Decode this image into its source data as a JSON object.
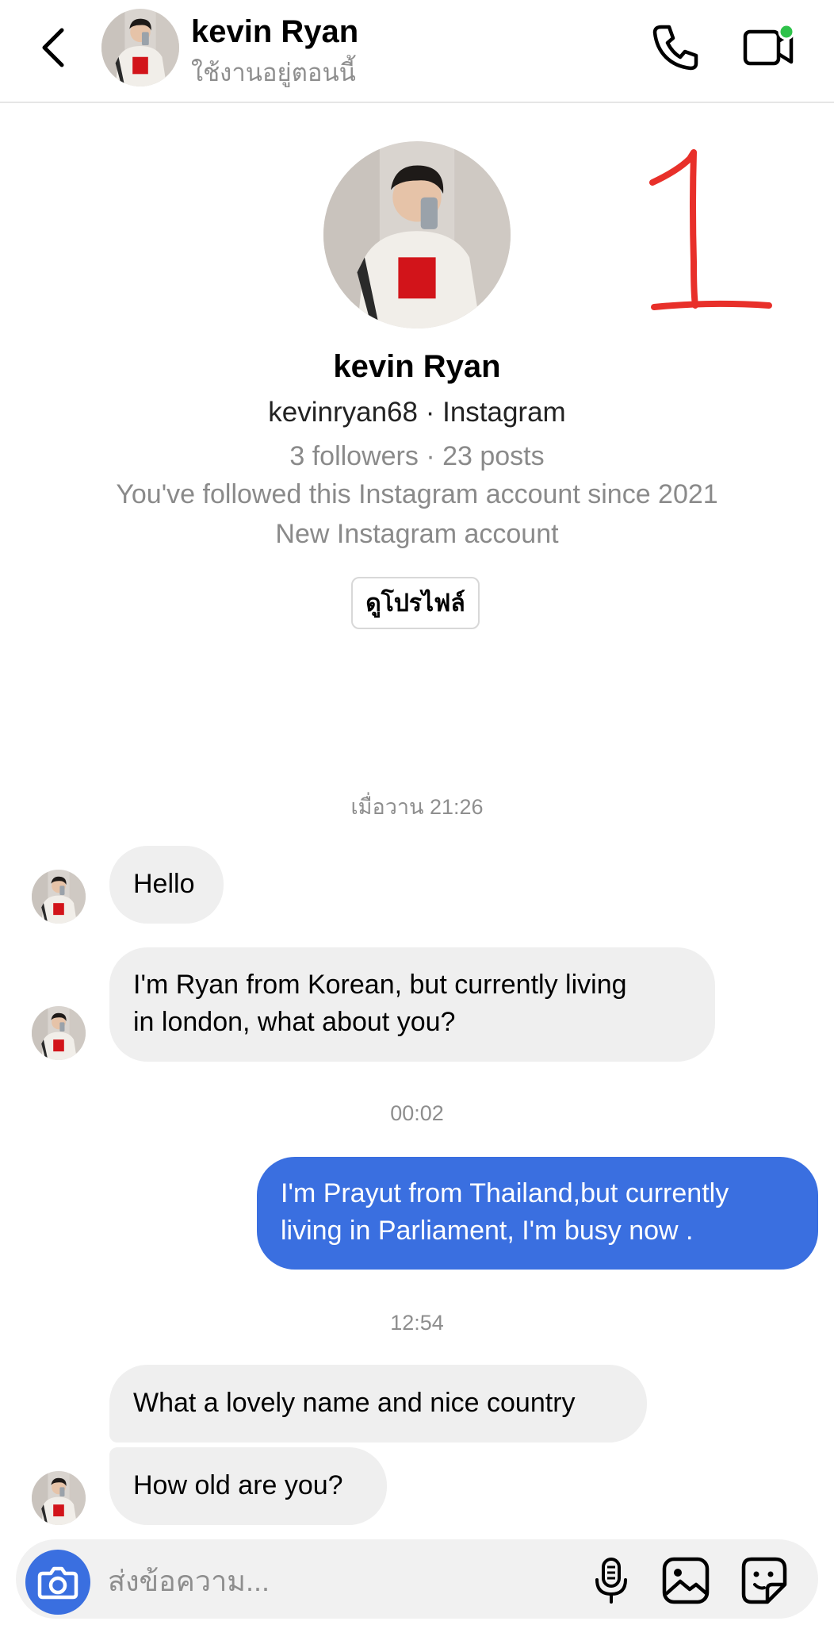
{
  "header": {
    "name": "kevin Ryan",
    "status": "ใช้งานอยู่ตอนนี้"
  },
  "profile": {
    "name": "kevin Ryan",
    "handle_line": "kevinryan68 · Instagram",
    "stats": "3 followers · 23 posts",
    "followed_since": "You've followed this Instagram account since 2021",
    "note": "New Instagram account",
    "view_profile_label": "ดูโปรไฟล์"
  },
  "timestamps": {
    "t1": "เมื่อวาน 21:26",
    "t2": "00:02",
    "t3": "12:54"
  },
  "messages": {
    "m1": "Hello",
    "m2_line1": "I'm Ryan from Korean, but currently living",
    "m2_line2": "in london, what about you?",
    "m3_line1": "I'm Prayut from Thailand,but currently",
    "m3_line2": "living in Parliament, I'm busy now .",
    "m4": "What a lovely name and nice country",
    "m5": "How old are you?"
  },
  "composer": {
    "placeholder": "ส่งข้อความ..."
  },
  "colors": {
    "accent": "#3a6fe0",
    "incoming_bubble": "#efefef",
    "online_dot": "#2ec24a",
    "annotation": "#e8302a"
  },
  "icons": [
    "back-icon",
    "phone-icon",
    "video-icon",
    "camera-icon",
    "microphone-icon",
    "gallery-icon",
    "sticker-icon"
  ]
}
